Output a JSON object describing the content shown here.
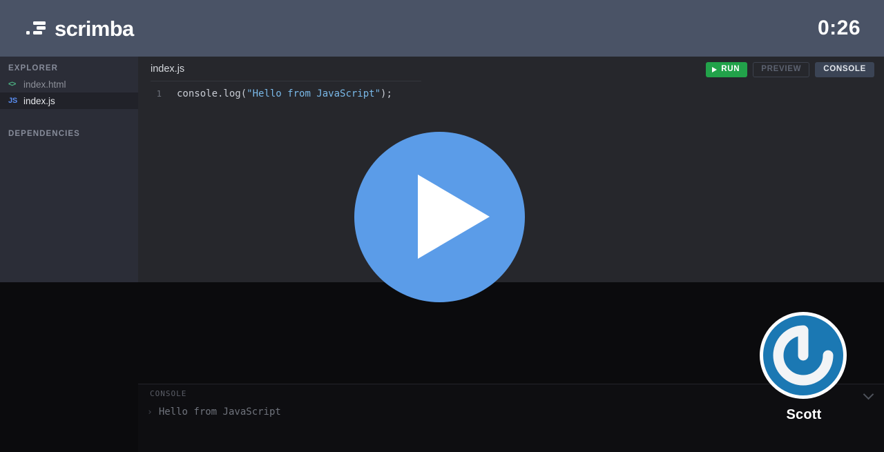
{
  "header": {
    "brand_name": "scrimba",
    "brand_mark_icon": "scrimba-logo-icon",
    "timer": "0:26"
  },
  "sidebar": {
    "explorer_label": "EXPLORER",
    "dependencies_label": "DEPENDENCIES",
    "files": [
      {
        "name": "index.html",
        "icon": "html-file-icon",
        "icon_glyph": "<>",
        "active": false
      },
      {
        "name": "index.js",
        "icon": "js-file-icon",
        "icon_glyph": "JS",
        "active": true
      }
    ]
  },
  "editor": {
    "tab_title": "index.js",
    "lines": [
      {
        "number": "1",
        "prefix": "console.log(",
        "string": "\"Hello from JavaScript\"",
        "suffix": ");"
      }
    ]
  },
  "toolbar": {
    "run_label": "RUN",
    "run_icon": "play-triangle-icon",
    "preview_label": "PREVIEW",
    "console_label": "CONSOLE"
  },
  "console": {
    "label": "CONSOLE",
    "collapse_icon": "chevron-down-icon",
    "caret": "›",
    "message": "Hello from JavaScript"
  },
  "player": {
    "play_icon": "play-triangle-icon"
  },
  "speaker": {
    "name": "Scott",
    "avatar_icon": "power-spiral-avatar-icon"
  },
  "colors": {
    "header_bg": "#4a5366",
    "sidebar_bg": "#2b2d37",
    "editor_bg": "#26272c",
    "page_bg": "#0b0b0d",
    "console_bg": "#0e0e11",
    "run_green": "#22a24a",
    "console_btn": "#3b4455",
    "play_blue": "#5b9ce8",
    "avatar_blue": "#1b78b3",
    "string_token": "#79b8e8",
    "html_icon": "#4caf82",
    "js_icon": "#5a8df0"
  }
}
